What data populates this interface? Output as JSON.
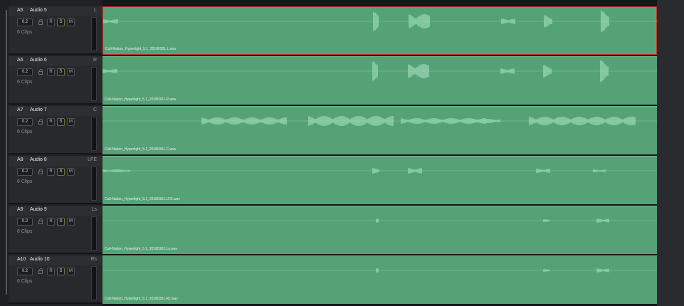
{
  "tracks": [
    {
      "id": "A5",
      "name": "Audio 5",
      "channel": "L",
      "volume": "0.2",
      "rec": "R",
      "solo": "S",
      "mute": "M",
      "clips": "6 Clips",
      "file": "Cult-Nation_Hyperlight_5.1_20180301.L.wav",
      "selected": true
    },
    {
      "id": "A6",
      "name": "Audio 6",
      "channel": "R",
      "volume": "0.2",
      "rec": "R",
      "solo": "S",
      "mute": "M",
      "clips": "6 Clips",
      "file": "Cult-Nation_Hyperlight_5.1_20180301.R.wav",
      "selected": false
    },
    {
      "id": "A7",
      "name": "Audio 7",
      "channel": "C",
      "volume": "0.2",
      "rec": "R",
      "solo": "S",
      "mute": "M",
      "clips": "6 Clips",
      "file": "Cult-Nation_Hyperlight_5.1_20180301.C.wav",
      "selected": false
    },
    {
      "id": "A8",
      "name": "Audio 8",
      "channel": "LFE",
      "volume": "0.2",
      "rec": "R",
      "solo": "S",
      "mute": "M",
      "clips": "6 Clips",
      "file": "Cult-Nation_Hyperlight_5.1_20180301.LFE.wav",
      "selected": false
    },
    {
      "id": "A9",
      "name": "Audio 9",
      "channel": "Ls",
      "volume": "0.2",
      "rec": "R",
      "solo": "S",
      "mute": "M",
      "clips": "6 Clips",
      "file": "Cult-Nation_Hyperlight_5.1_20180301.Ls.wav",
      "selected": false
    },
    {
      "id": "A10",
      "name": "Audio 10",
      "channel": "Rs",
      "volume": "0.2",
      "rec": "R",
      "solo": "S",
      "mute": "M",
      "clips": "6 Clips",
      "file": "Cult-Nation_Hyperlight_5.1_20180301.Rs.wav",
      "selected": false
    }
  ],
  "colors": {
    "clip": "#56a277",
    "waveform": "#9fe0bb",
    "selected_border": "#c0392b"
  },
  "icons": {
    "lock": "lock-icon"
  }
}
